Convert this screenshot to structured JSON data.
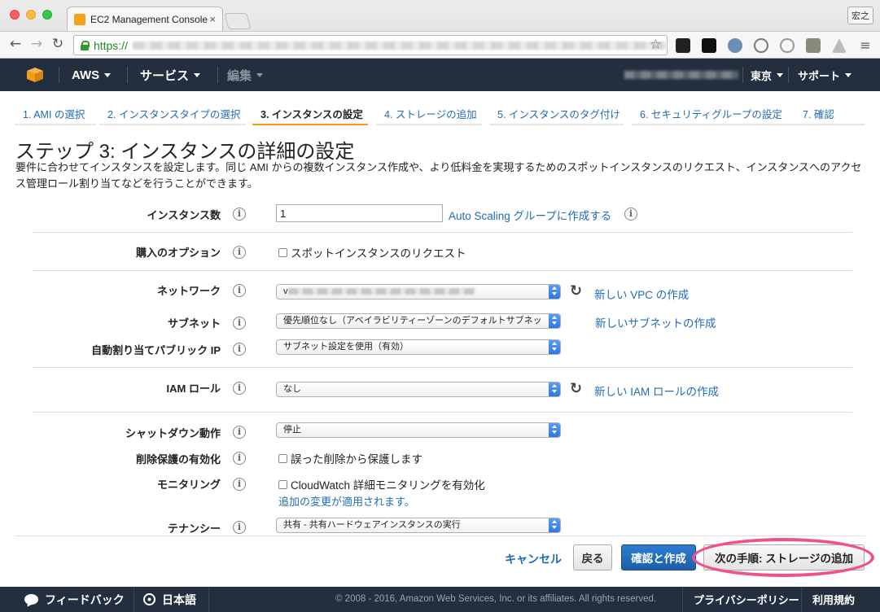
{
  "browser": {
    "tab_title": "EC2 Management Console",
    "tab_close": "×",
    "user_badge": "宏之",
    "url_scheme": "https://"
  },
  "header": {
    "aws": "AWS",
    "services": "サービス",
    "edit": "編集",
    "region": "東京",
    "support": "サポート"
  },
  "steps": [
    {
      "label": "1. AMI の選択"
    },
    {
      "label": "2. インスタンスタイプの選択"
    },
    {
      "label": "3. インスタンスの設定"
    },
    {
      "label": "4. ストレージの追加"
    },
    {
      "label": "5. インスタンスのタグ付け"
    },
    {
      "label": "6. セキュリティグループの設定"
    },
    {
      "label": "7. 確認"
    }
  ],
  "page": {
    "title": "ステップ 3: インスタンスの詳細の設定",
    "description": "要件に合わせてインスタンスを設定します。同じ AMI からの複数インスタンス作成や、より低料金を実現するためのスポットインスタンスのリクエスト、インスタンスへのアクセス管理ロール割り当てなどを行うことができます。"
  },
  "form": {
    "instance_count": {
      "label": "インスタンス数",
      "value": "1",
      "link": "Auto Scaling グループに作成する"
    },
    "purchase_option": {
      "label": "購入のオプション",
      "checkbox": "スポットインスタンスのリクエスト"
    },
    "network": {
      "label": "ネットワーク",
      "prefix": "v",
      "link": "新しい VPC の作成"
    },
    "subnet": {
      "label": "サブネット",
      "value": "優先順位なし（アベイラビリティーゾーンのデフォルトサブネッ",
      "link": "新しいサブネットの作成"
    },
    "public_ip": {
      "label": "自動割り当てパブリック IP",
      "value": "サブネット設定を使用（有効）"
    },
    "iam_role": {
      "label": "IAM ロール",
      "value": "なし",
      "link": "新しい IAM ロールの作成"
    },
    "shutdown": {
      "label": "シャットダウン動作",
      "value": "停止"
    },
    "termination": {
      "label": "削除保護の有効化",
      "checkbox": "誤った削除から保護します"
    },
    "monitoring": {
      "label": "モニタリング",
      "checkbox": "CloudWatch 詳細モニタリングを有効化",
      "note": "追加の変更が適用されます。"
    },
    "tenancy": {
      "label": "テナンシー",
      "value": "共有 - 共有ハードウェアインスタンスの実行"
    }
  },
  "info_glyph": "i",
  "refresh_glyph": "↻",
  "buttons": {
    "cancel": "キャンセル",
    "back": "戻る",
    "review": "確認と作成",
    "next": "次の手順: ストレージの追加"
  },
  "footer": {
    "feedback": "フィードバック",
    "language": "日本語",
    "copyright": "© 2008 - 2016, Amazon Web Services, Inc. or its affiliates. All rights reserved.",
    "privacy": "プライバシーポリシー",
    "terms": "利用規約"
  },
  "colors": {
    "aws_header": "#232f3e",
    "link": "#1f6bb6",
    "active_step_underline": "#f39c12",
    "primary_button": "#1b5ea8",
    "highlight_ring": "#f0508e"
  }
}
